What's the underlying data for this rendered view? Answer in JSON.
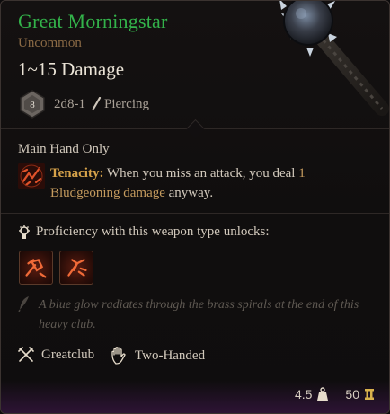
{
  "item": {
    "name": "Great Morningstar",
    "rarity": "Uncommon",
    "damage_range": "1~15 Damage",
    "die_face": "8",
    "damage_roll": "2d8-1",
    "damage_type": "Piercing"
  },
  "requirement": "Main Hand Only",
  "passive": {
    "name": "Tenacity:",
    "text_1": " When you miss an attack, you deal ",
    "amount": "1",
    "damage_kind": "Bludgeoning damage",
    "text_2": " anyway."
  },
  "proficiency": {
    "label": "Proficiency with this weapon type unlocks:",
    "abilities": [
      "ability-icon-1",
      "ability-icon-2"
    ]
  },
  "flavor_text": "A blue glow radiates through the brass spirals at the end of this heavy club.",
  "properties": [
    {
      "icon": "crossed-weapons-icon",
      "label": "Greatclub"
    },
    {
      "icon": "hand-icon",
      "label": "Two-Handed"
    }
  ],
  "footer": {
    "weight": "4.5",
    "price": "50"
  },
  "colors": {
    "name": "#33b24a",
    "rarity": "#8b6a45",
    "keyword": "#d6a24a",
    "highlight": "#c59b5e",
    "flavor": "#5f5952"
  }
}
